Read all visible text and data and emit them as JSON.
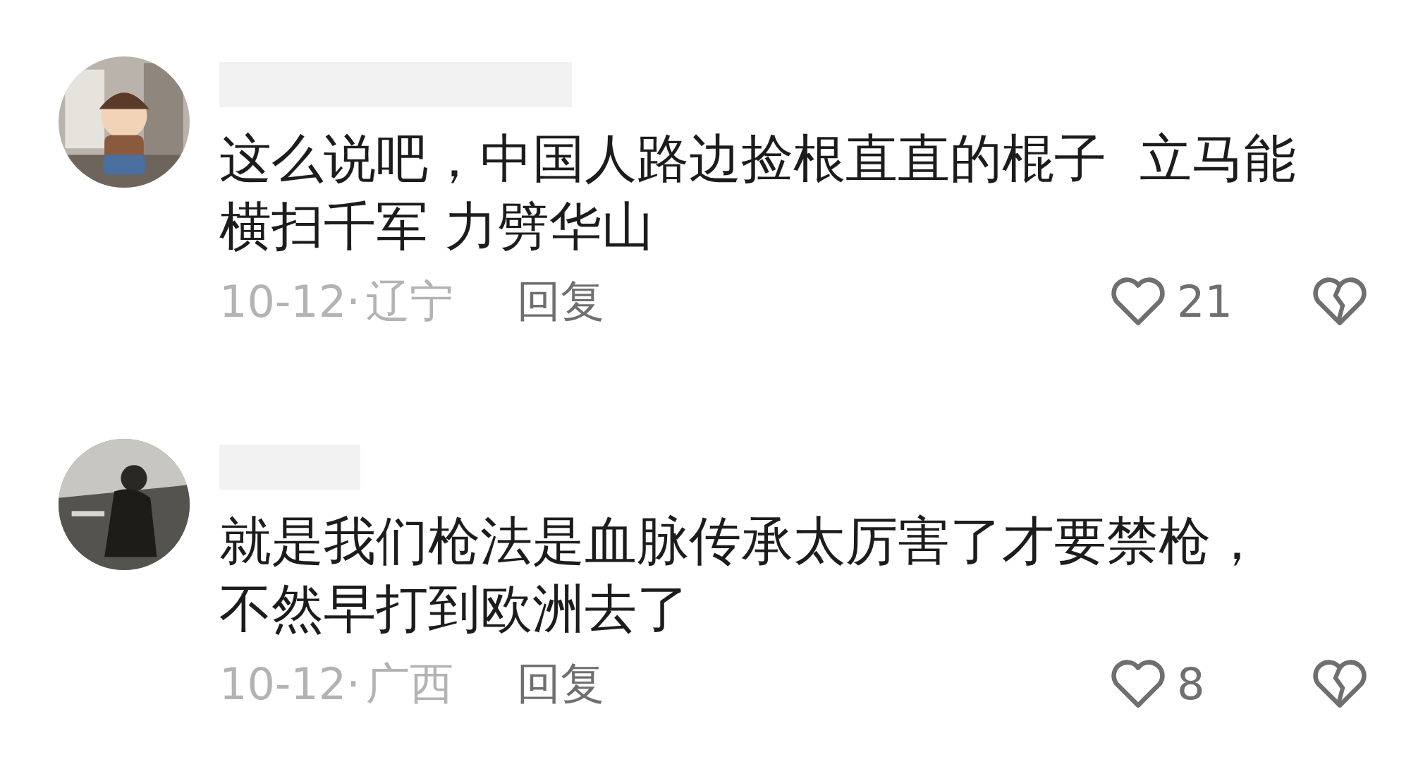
{
  "comments": [
    {
      "lines": [
        "这么说吧，中国人路边捡根直直的棍子  立马能",
        "横扫千军 力劈华山"
      ],
      "date": "10-12·",
      "location": "辽宁",
      "reply": "回复",
      "likes": "21"
    },
    {
      "lines": [
        "就是我们枪法是血脉传承太厉害了才要禁枪，",
        "不然早打到欧洲去了"
      ],
      "date": "10-12·",
      "location": "广西",
      "reply": "回复",
      "likes": "8"
    }
  ]
}
